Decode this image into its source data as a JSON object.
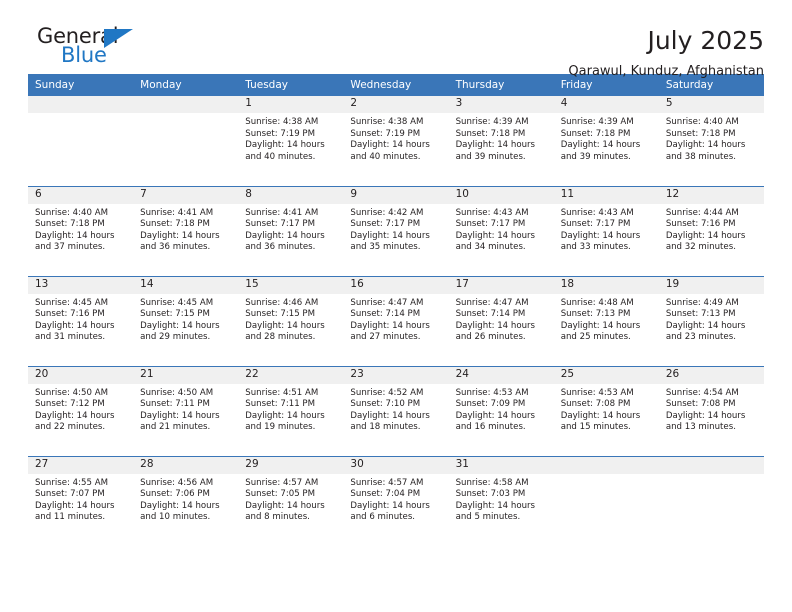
{
  "brand": {
    "name_part1": "General",
    "name_part2": "Blue",
    "triangle_color": "#2077c4",
    "blue_color": "#2077c4"
  },
  "header": {
    "title": "July 2025",
    "subtitle": "Qarawul, Kunduz, Afghanistan"
  },
  "theme": {
    "header_blue": "#3a76b8",
    "daynum_band": "#f0f0f0",
    "text": "#231f20"
  },
  "weekdays": [
    "Sunday",
    "Monday",
    "Tuesday",
    "Wednesday",
    "Thursday",
    "Friday",
    "Saturday"
  ],
  "weeks": [
    [
      {
        "day": "",
        "empty": true
      },
      {
        "day": "",
        "empty": true
      },
      {
        "day": "1",
        "sunrise": "Sunrise: 4:38 AM",
        "sunset": "Sunset: 7:19 PM",
        "daylight_line1": "Daylight: 14 hours",
        "daylight_line2": "and 40 minutes."
      },
      {
        "day": "2",
        "sunrise": "Sunrise: 4:38 AM",
        "sunset": "Sunset: 7:19 PM",
        "daylight_line1": "Daylight: 14 hours",
        "daylight_line2": "and 40 minutes."
      },
      {
        "day": "3",
        "sunrise": "Sunrise: 4:39 AM",
        "sunset": "Sunset: 7:18 PM",
        "daylight_line1": "Daylight: 14 hours",
        "daylight_line2": "and 39 minutes."
      },
      {
        "day": "4",
        "sunrise": "Sunrise: 4:39 AM",
        "sunset": "Sunset: 7:18 PM",
        "daylight_line1": "Daylight: 14 hours",
        "daylight_line2": "and 39 minutes."
      },
      {
        "day": "5",
        "sunrise": "Sunrise: 4:40 AM",
        "sunset": "Sunset: 7:18 PM",
        "daylight_line1": "Daylight: 14 hours",
        "daylight_line2": "and 38 minutes."
      }
    ],
    [
      {
        "day": "6",
        "sunrise": "Sunrise: 4:40 AM",
        "sunset": "Sunset: 7:18 PM",
        "daylight_line1": "Daylight: 14 hours",
        "daylight_line2": "and 37 minutes."
      },
      {
        "day": "7",
        "sunrise": "Sunrise: 4:41 AM",
        "sunset": "Sunset: 7:18 PM",
        "daylight_line1": "Daylight: 14 hours",
        "daylight_line2": "and 36 minutes."
      },
      {
        "day": "8",
        "sunrise": "Sunrise: 4:41 AM",
        "sunset": "Sunset: 7:17 PM",
        "daylight_line1": "Daylight: 14 hours",
        "daylight_line2": "and 36 minutes."
      },
      {
        "day": "9",
        "sunrise": "Sunrise: 4:42 AM",
        "sunset": "Sunset: 7:17 PM",
        "daylight_line1": "Daylight: 14 hours",
        "daylight_line2": "and 35 minutes."
      },
      {
        "day": "10",
        "sunrise": "Sunrise: 4:43 AM",
        "sunset": "Sunset: 7:17 PM",
        "daylight_line1": "Daylight: 14 hours",
        "daylight_line2": "and 34 minutes."
      },
      {
        "day": "11",
        "sunrise": "Sunrise: 4:43 AM",
        "sunset": "Sunset: 7:17 PM",
        "daylight_line1": "Daylight: 14 hours",
        "daylight_line2": "and 33 minutes."
      },
      {
        "day": "12",
        "sunrise": "Sunrise: 4:44 AM",
        "sunset": "Sunset: 7:16 PM",
        "daylight_line1": "Daylight: 14 hours",
        "daylight_line2": "and 32 minutes."
      }
    ],
    [
      {
        "day": "13",
        "sunrise": "Sunrise: 4:45 AM",
        "sunset": "Sunset: 7:16 PM",
        "daylight_line1": "Daylight: 14 hours",
        "daylight_line2": "and 31 minutes."
      },
      {
        "day": "14",
        "sunrise": "Sunrise: 4:45 AM",
        "sunset": "Sunset: 7:15 PM",
        "daylight_line1": "Daylight: 14 hours",
        "daylight_line2": "and 29 minutes."
      },
      {
        "day": "15",
        "sunrise": "Sunrise: 4:46 AM",
        "sunset": "Sunset: 7:15 PM",
        "daylight_line1": "Daylight: 14 hours",
        "daylight_line2": "and 28 minutes."
      },
      {
        "day": "16",
        "sunrise": "Sunrise: 4:47 AM",
        "sunset": "Sunset: 7:14 PM",
        "daylight_line1": "Daylight: 14 hours",
        "daylight_line2": "and 27 minutes."
      },
      {
        "day": "17",
        "sunrise": "Sunrise: 4:47 AM",
        "sunset": "Sunset: 7:14 PM",
        "daylight_line1": "Daylight: 14 hours",
        "daylight_line2": "and 26 minutes."
      },
      {
        "day": "18",
        "sunrise": "Sunrise: 4:48 AM",
        "sunset": "Sunset: 7:13 PM",
        "daylight_line1": "Daylight: 14 hours",
        "daylight_line2": "and 25 minutes."
      },
      {
        "day": "19",
        "sunrise": "Sunrise: 4:49 AM",
        "sunset": "Sunset: 7:13 PM",
        "daylight_line1": "Daylight: 14 hours",
        "daylight_line2": "and 23 minutes."
      }
    ],
    [
      {
        "day": "20",
        "sunrise": "Sunrise: 4:50 AM",
        "sunset": "Sunset: 7:12 PM",
        "daylight_line1": "Daylight: 14 hours",
        "daylight_line2": "and 22 minutes."
      },
      {
        "day": "21",
        "sunrise": "Sunrise: 4:50 AM",
        "sunset": "Sunset: 7:11 PM",
        "daylight_line1": "Daylight: 14 hours",
        "daylight_line2": "and 21 minutes."
      },
      {
        "day": "22",
        "sunrise": "Sunrise: 4:51 AM",
        "sunset": "Sunset: 7:11 PM",
        "daylight_line1": "Daylight: 14 hours",
        "daylight_line2": "and 19 minutes."
      },
      {
        "day": "23",
        "sunrise": "Sunrise: 4:52 AM",
        "sunset": "Sunset: 7:10 PM",
        "daylight_line1": "Daylight: 14 hours",
        "daylight_line2": "and 18 minutes."
      },
      {
        "day": "24",
        "sunrise": "Sunrise: 4:53 AM",
        "sunset": "Sunset: 7:09 PM",
        "daylight_line1": "Daylight: 14 hours",
        "daylight_line2": "and 16 minutes."
      },
      {
        "day": "25",
        "sunrise": "Sunrise: 4:53 AM",
        "sunset": "Sunset: 7:08 PM",
        "daylight_line1": "Daylight: 14 hours",
        "daylight_line2": "and 15 minutes."
      },
      {
        "day": "26",
        "sunrise": "Sunrise: 4:54 AM",
        "sunset": "Sunset: 7:08 PM",
        "daylight_line1": "Daylight: 14 hours",
        "daylight_line2": "and 13 minutes."
      }
    ],
    [
      {
        "day": "27",
        "sunrise": "Sunrise: 4:55 AM",
        "sunset": "Sunset: 7:07 PM",
        "daylight_line1": "Daylight: 14 hours",
        "daylight_line2": "and 11 minutes."
      },
      {
        "day": "28",
        "sunrise": "Sunrise: 4:56 AM",
        "sunset": "Sunset: 7:06 PM",
        "daylight_line1": "Daylight: 14 hours",
        "daylight_line2": "and 10 minutes."
      },
      {
        "day": "29",
        "sunrise": "Sunrise: 4:57 AM",
        "sunset": "Sunset: 7:05 PM",
        "daylight_line1": "Daylight: 14 hours",
        "daylight_line2": "and 8 minutes."
      },
      {
        "day": "30",
        "sunrise": "Sunrise: 4:57 AM",
        "sunset": "Sunset: 7:04 PM",
        "daylight_line1": "Daylight: 14 hours",
        "daylight_line2": "and 6 minutes."
      },
      {
        "day": "31",
        "sunrise": "Sunrise: 4:58 AM",
        "sunset": "Sunset: 7:03 PM",
        "daylight_line1": "Daylight: 14 hours",
        "daylight_line2": "and 5 minutes."
      },
      {
        "day": "",
        "empty": true
      },
      {
        "day": "",
        "empty": true
      }
    ]
  ]
}
